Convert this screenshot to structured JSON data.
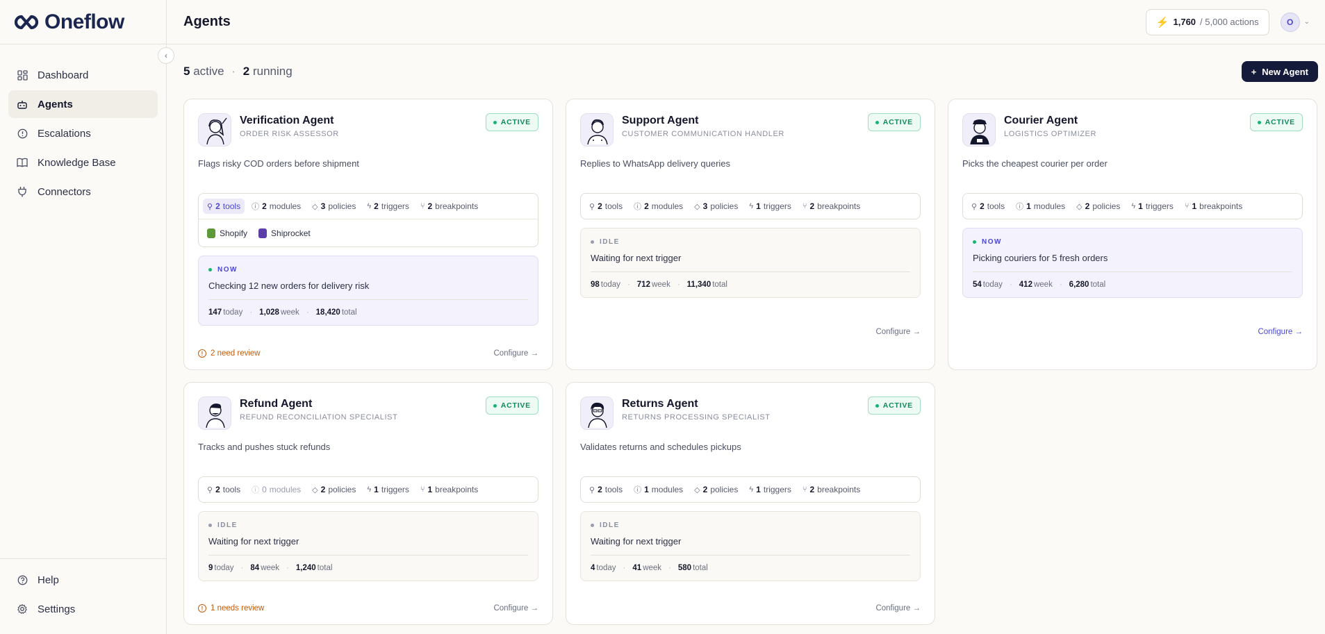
{
  "brand": {
    "name": "Oneflow"
  },
  "sidebar": {
    "items": [
      {
        "label": "Dashboard",
        "icon": "dashboard-icon",
        "active": false
      },
      {
        "label": "Agents",
        "icon": "bot-icon",
        "active": true
      },
      {
        "label": "Escalations",
        "icon": "alert-circle-icon",
        "active": false
      },
      {
        "label": "Knowledge Base",
        "icon": "book-icon",
        "active": false
      },
      {
        "label": "Connectors",
        "icon": "plug-icon",
        "active": false
      }
    ],
    "bottom": [
      {
        "label": "Help",
        "icon": "help-icon"
      },
      {
        "label": "Settings",
        "icon": "gear-icon"
      }
    ]
  },
  "header": {
    "title": "Agents",
    "usage_used": "1,760",
    "usage_total": "/ 5,000 actions",
    "avatar_initial": "O"
  },
  "summary": {
    "active_count": "5",
    "active_label": "active",
    "running_count": "2",
    "running_label": "running"
  },
  "new_agent_label": "New Agent",
  "colors": {
    "accent": "#4a47d6",
    "active_green": "#18b374",
    "warning": "#c25b0b",
    "dark_button": "#141a3a"
  },
  "agents": [
    {
      "name": "Verification Agent",
      "role": "ORDER RISK ASSESSOR",
      "status": "ACTIVE",
      "description": "Flags risky COD orders before shipment",
      "caps": {
        "tools": "2",
        "modules": "2",
        "policies": "3",
        "triggers": "2",
        "breakpoints": "2"
      },
      "connectors": [
        "Shopify",
        "Shiprocket"
      ],
      "activity_state": "NOW",
      "activity_text": "Checking 12 new orders for delivery risk",
      "stats": {
        "today": "147",
        "week": "1,028",
        "total": "18,420"
      },
      "review": "2 need review",
      "configure": "Configure →"
    },
    {
      "name": "Support Agent",
      "role": "CUSTOMER COMMUNICATION HANDLER",
      "status": "ACTIVE",
      "description": "Replies to WhatsApp delivery queries",
      "caps": {
        "tools": "2",
        "modules": "2",
        "policies": "3",
        "triggers": "1",
        "breakpoints": "2"
      },
      "activity_state": "IDLE",
      "activity_text": "Waiting for next trigger",
      "stats": {
        "today": "98",
        "week": "712",
        "total": "11,340"
      },
      "configure": "Configure →"
    },
    {
      "name": "Courier Agent",
      "role": "LOGISTICS OPTIMIZER",
      "status": "ACTIVE",
      "description": "Picks the cheapest courier per order",
      "caps": {
        "tools": "2",
        "modules": "1",
        "policies": "2",
        "triggers": "1",
        "breakpoints": "1"
      },
      "activity_state": "NOW",
      "activity_text": "Picking couriers for 5 fresh orders",
      "stats": {
        "today": "54",
        "week": "412",
        "total": "6,280"
      },
      "configure": "Configure →"
    },
    {
      "name": "Refund Agent",
      "role": "REFUND RECONCILIATION SPECIALIST",
      "status": "ACTIVE",
      "description": "Tracks and pushes stuck refunds",
      "caps": {
        "tools": "2",
        "modules": "0",
        "policies": "2",
        "triggers": "1",
        "breakpoints": "1"
      },
      "activity_state": "IDLE",
      "activity_text": "Waiting for next trigger",
      "stats": {
        "today": "9",
        "week": "84",
        "total": "1,240"
      },
      "review": "1 needs review",
      "configure": "Configure →"
    },
    {
      "name": "Returns Agent",
      "role": "RETURNS PROCESSING SPECIALIST",
      "status": "ACTIVE",
      "description": "Validates returns and schedules pickups",
      "caps": {
        "tools": "2",
        "modules": "1",
        "policies": "2",
        "triggers": "1",
        "breakpoints": "2"
      },
      "activity_state": "IDLE",
      "activity_text": "Waiting for next trigger",
      "stats": {
        "today": "4",
        "week": "41",
        "total": "580"
      },
      "configure": "Configure →"
    }
  ],
  "labels": {
    "tools": "tools",
    "modules": "modules",
    "policies": "policies",
    "triggers": "triggers",
    "breakpoints": "breakpoints",
    "today": "today",
    "week": "week",
    "total": "total"
  }
}
